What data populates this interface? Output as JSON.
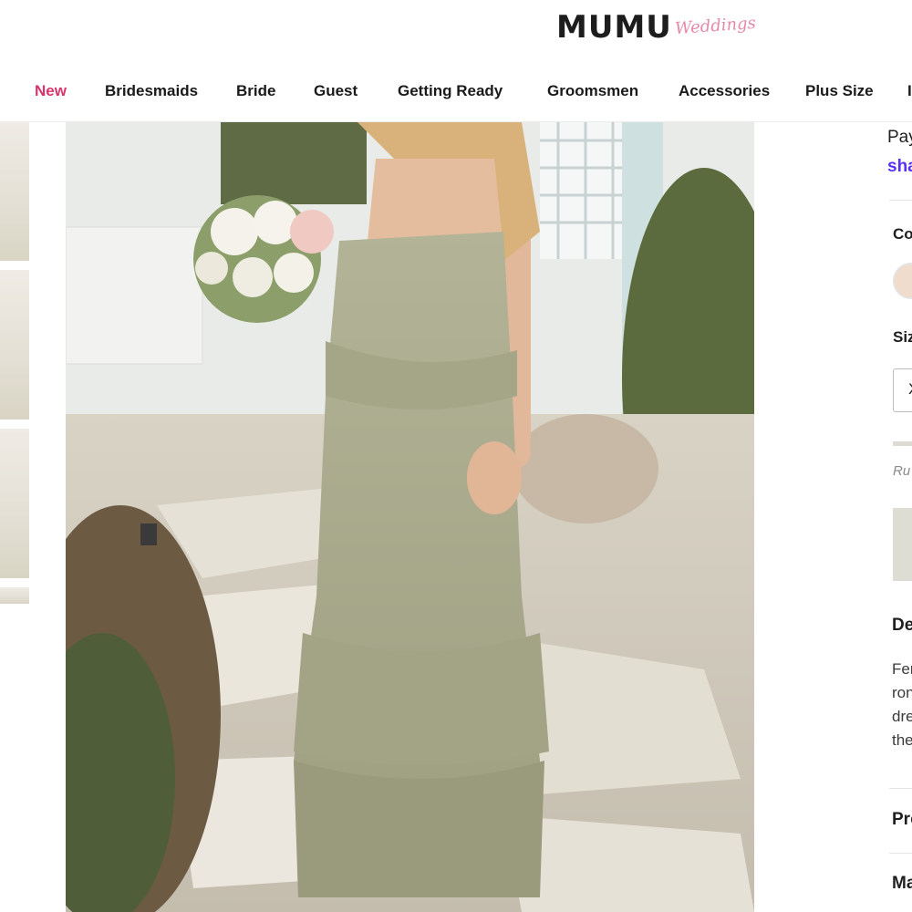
{
  "header": {
    "logo": "MUMU",
    "logo_script": "Weddings"
  },
  "nav": {
    "items": [
      {
        "label": "New",
        "active": true
      },
      {
        "label": "Bridesmaids",
        "active": false
      },
      {
        "label": "Bride",
        "active": false
      },
      {
        "label": "Guest",
        "active": false
      },
      {
        "label": "Getting Ready",
        "active": false
      },
      {
        "label": "Groomsmen",
        "active": false
      },
      {
        "label": "Accessories",
        "active": false
      },
      {
        "label": "Plus Size",
        "active": false
      },
      {
        "label": "I",
        "active": false
      }
    ],
    "active_color": "#d8346b"
  },
  "product": {
    "payment_text": "Pay",
    "shop_pay_text": "sha",
    "color_label": "Co",
    "size_label": "Siz",
    "size_value": "X",
    "runs_text": "Ru",
    "details_heading": "De",
    "description_lines": [
      "Fer",
      "ron",
      "dre",
      "the"
    ],
    "section_product": "Pro",
    "section_more": "Ma"
  },
  "images": {
    "main": "bridesmaid-sage-ruffle-dress-photo",
    "thumbnails": [
      "thumbnail-1",
      "thumbnail-2",
      "thumbnail-3",
      "thumbnail-4"
    ]
  },
  "colors": {
    "accent": "#d8346b",
    "shop_pay": "#5a31f4",
    "dress": "#a8a88c"
  }
}
